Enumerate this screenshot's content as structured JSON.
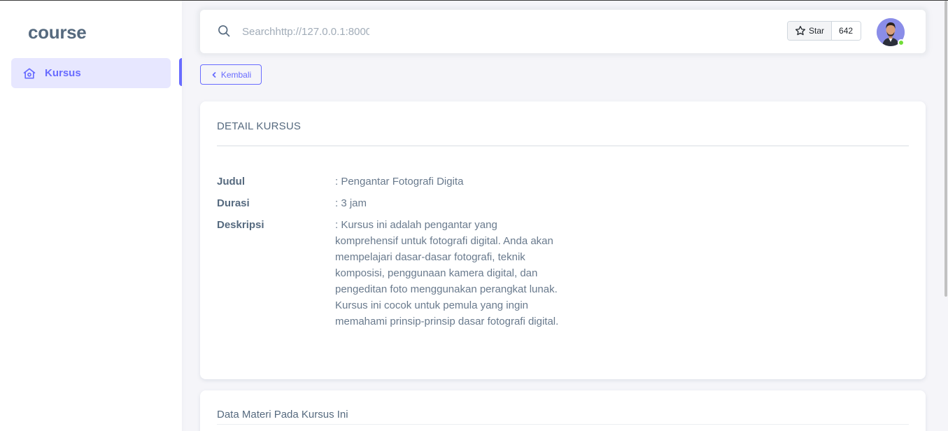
{
  "sidebar": {
    "brand": "course",
    "items": [
      {
        "label": "Kursus",
        "icon": "home-icon",
        "active": true
      }
    ]
  },
  "navbar": {
    "search_placeholder": "Searchhttp://127.0.0.1:8000",
    "star_label": "Star",
    "star_count": "642",
    "avatar_status": "online"
  },
  "back_button": {
    "label": "Kembali"
  },
  "detail": {
    "title": "DETAIL KURSUS",
    "rows": [
      {
        "label": "Judul",
        "value": ": Pengantar Fotografi Digita"
      },
      {
        "label": "Durasi",
        "value": ": 3 jam"
      },
      {
        "label": "Deskripsi",
        "value": ": Kursus ini adalah pengantar yang komprehensif untuk fotografi digital. Anda akan mempelajari dasar-dasar fotografi, teknik komposisi, penggunaan kamera digital, dan pengeditan foto menggunakan perangkat lunak. Kursus ini cocok untuk pemula yang ingin memahami prinsip-prinsip dasar fotografi digital."
      }
    ]
  },
  "materials": {
    "title": "Data Materi Pada Kursus Ini"
  },
  "colors": {
    "primary": "#696cff",
    "primary_light": "#e7e7ff",
    "online": "#71dd37",
    "background": "#f5f5f9"
  }
}
